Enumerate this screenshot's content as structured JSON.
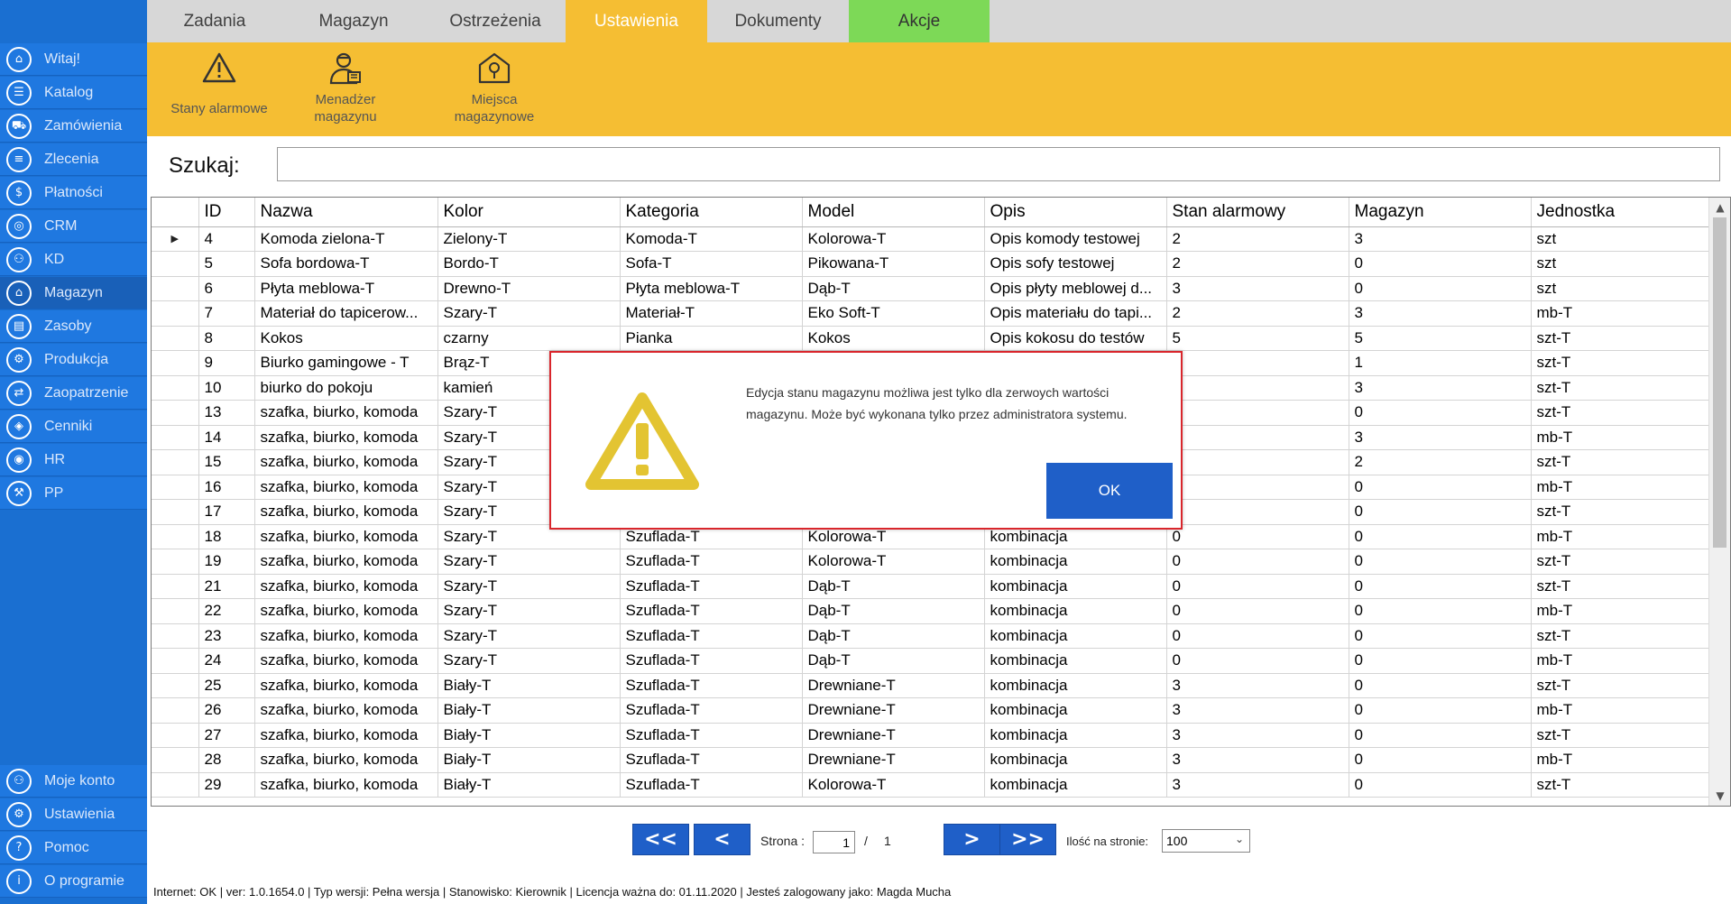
{
  "sidebar": {
    "items": [
      {
        "label": "Witaj!",
        "icon": "⌂"
      },
      {
        "label": "Katalog",
        "icon": "☰"
      },
      {
        "label": "Zamówienia",
        "icon": "⛟"
      },
      {
        "label": "Zlecenia",
        "icon": "≡"
      },
      {
        "label": "Płatności",
        "icon": "$"
      },
      {
        "label": "CRM",
        "icon": "◎"
      },
      {
        "label": "KD",
        "icon": "⚇"
      },
      {
        "label": "Magazyn",
        "icon": "⌂"
      },
      {
        "label": "Zasoby",
        "icon": "▤"
      },
      {
        "label": "Produkcja",
        "icon": "⚙"
      },
      {
        "label": "Zaopatrzenie",
        "icon": "⇄"
      },
      {
        "label": "Cenniki",
        "icon": "◈"
      },
      {
        "label": "HR",
        "icon": "◉"
      },
      {
        "label": "PP",
        "icon": "⚒"
      }
    ],
    "bottom": [
      {
        "label": "Moje konto",
        "icon": "⚇"
      },
      {
        "label": "Ustawienia",
        "icon": "⚙"
      },
      {
        "label": "Pomoc",
        "icon": "?"
      },
      {
        "label": "O programie",
        "icon": "i"
      }
    ]
  },
  "tabs": [
    "Zadania",
    "Magazyn",
    "Ostrzeżenia",
    "Ustawienia",
    "Dokumenty",
    "Akcje"
  ],
  "ribbon": {
    "alarm_states": "Stany alarmowe",
    "warehouse_manager_1": "Menadżer",
    "warehouse_manager_2": "magazynu",
    "storage_places_1": "Miejsca",
    "storage_places_2": "magazynowe"
  },
  "search": {
    "label": "Szukaj:",
    "value": ""
  },
  "grid": {
    "headers": [
      "ID",
      "Nazwa",
      "Kolor",
      "Kategoria",
      "Model",
      "Opis",
      "Stan alarmowy",
      "Magazyn",
      "Jednostka"
    ],
    "rows": [
      [
        "4",
        "Komoda zielona-T",
        "Zielony-T",
        "Komoda-T",
        "Kolorowa-T",
        "Opis komody testowej",
        "2",
        "3",
        "szt"
      ],
      [
        "5",
        "Sofa bordowa-T",
        "Bordo-T",
        "Sofa-T",
        "Pikowana-T",
        "Opis sofy testowej",
        "2",
        "0",
        "szt"
      ],
      [
        "6",
        "Płyta meblowa-T",
        "Drewno-T",
        "Płyta meblowa-T",
        "Dąb-T",
        "Opis płyty meblowej d...",
        "3",
        "0",
        "szt"
      ],
      [
        "7",
        "Materiał do tapicerow...",
        "Szary-T",
        "Materiał-T",
        "Eko Soft-T",
        "Opis materiału do tapi...",
        "2",
        "3",
        "mb-T"
      ],
      [
        "8",
        "Kokos",
        "czarny",
        "Pianka",
        "Kokos",
        "Opis kokosu do testów",
        "5",
        "5",
        "szt-T"
      ],
      [
        "9",
        "Biurko gamingowe - T",
        "Brąz-T",
        "",
        "",
        "",
        "",
        "1",
        "szt-T"
      ],
      [
        "10",
        "biurko do pokoju",
        "kamień",
        "",
        "",
        "",
        "",
        "3",
        "szt-T"
      ],
      [
        "13",
        "szafka, biurko, komoda",
        "Szary-T",
        "",
        "",
        "",
        "",
        "0",
        "szt-T"
      ],
      [
        "14",
        "szafka, biurko, komoda",
        "Szary-T",
        "",
        "",
        "",
        "",
        "3",
        "mb-T"
      ],
      [
        "15",
        "szafka, biurko, komoda",
        "Szary-T",
        "",
        "",
        "",
        "",
        "2",
        "szt-T"
      ],
      [
        "16",
        "szafka, biurko, komoda",
        "Szary-T",
        "",
        "",
        "",
        "",
        "0",
        "mb-T"
      ],
      [
        "17",
        "szafka, biurko, komoda",
        "Szary-T",
        "",
        "",
        "",
        "",
        "0",
        "szt-T"
      ],
      [
        "18",
        "szafka, biurko, komoda",
        "Szary-T",
        "Szuflada-T",
        "Kolorowa-T",
        "kombinacja",
        "0",
        "0",
        "mb-T"
      ],
      [
        "19",
        "szafka, biurko, komoda",
        "Szary-T",
        "Szuflada-T",
        "Kolorowa-T",
        "kombinacja",
        "0",
        "0",
        "szt-T"
      ],
      [
        "21",
        "szafka, biurko, komoda",
        "Szary-T",
        "Szuflada-T",
        "Dąb-T",
        "kombinacja",
        "0",
        "0",
        "szt-T"
      ],
      [
        "22",
        "szafka, biurko, komoda",
        "Szary-T",
        "Szuflada-T",
        "Dąb-T",
        "kombinacja",
        "0",
        "0",
        "mb-T"
      ],
      [
        "23",
        "szafka, biurko, komoda",
        "Szary-T",
        "Szuflada-T",
        "Dąb-T",
        "kombinacja",
        "0",
        "0",
        "szt-T"
      ],
      [
        "24",
        "szafka, biurko, komoda",
        "Szary-T",
        "Szuflada-T",
        "Dąb-T",
        "kombinacja",
        "0",
        "0",
        "mb-T"
      ],
      [
        "25",
        "szafka, biurko, komoda",
        "Biały-T",
        "Szuflada-T",
        "Drewniane-T",
        "kombinacja",
        "3",
        "0",
        "szt-T"
      ],
      [
        "26",
        "szafka, biurko, komoda",
        "Biały-T",
        "Szuflada-T",
        "Drewniane-T",
        "kombinacja",
        "3",
        "0",
        "mb-T"
      ],
      [
        "27",
        "szafka, biurko, komoda",
        "Biały-T",
        "Szuflada-T",
        "Drewniane-T",
        "kombinacja",
        "3",
        "0",
        "szt-T"
      ],
      [
        "28",
        "szafka, biurko, komoda",
        "Biały-T",
        "Szuflada-T",
        "Drewniane-T",
        "kombinacja",
        "3",
        "0",
        "mb-T"
      ],
      [
        "29",
        "szafka, biurko, komoda",
        "Biały-T",
        "Szuflada-T",
        "Kolorowa-T",
        "kombinacja",
        "3",
        "0",
        "szt-T"
      ]
    ]
  },
  "pager": {
    "first": "<<",
    "prev": "<",
    "next": ">",
    "last": ">>",
    "page_label": "Strona :",
    "page_value": "1",
    "separator": "/",
    "page_total": "1",
    "per_page_label": "Ilość na stronie:",
    "per_page_value": "100"
  },
  "status": "Internet: OK  |  ver: 1.0.1654.0  |  Typ wersji: Pełna wersja  |  Stanowisko: Kierownik  |  Licencja ważna do: 01.11.2020  |  Jesteś zalogowany jako: Magda Mucha",
  "modal": {
    "message": "Edycja stanu magazynu możliwa jest tylko dla zerwoych wartości magazynu. Może być wykonana tylko przez administratora systemu.",
    "ok": "OK"
  },
  "colors": {
    "sidebar": "#1f78e0",
    "accent": "#f5be33",
    "akcje_tab": "#7dd957",
    "button": "#1f5fc8",
    "modal_border": "#d9262c",
    "warning_icon": "#e3c432"
  }
}
